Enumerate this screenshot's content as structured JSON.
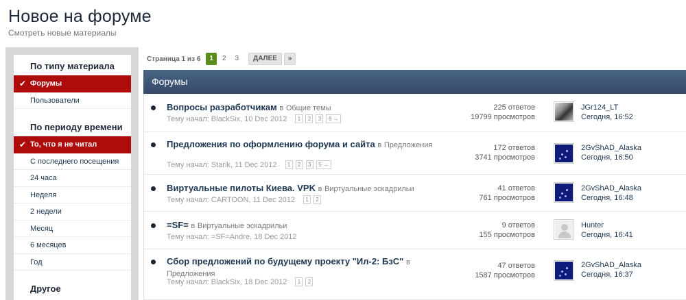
{
  "header": {
    "title": "Новое на форуме",
    "subtitle": "Смотреть новые материалы"
  },
  "sidebar": {
    "groups": [
      {
        "heading": "По типу материала",
        "items": [
          {
            "label": "Форумы",
            "active": true
          },
          {
            "label": "Пользователи",
            "active": false
          }
        ]
      },
      {
        "heading": "По периоду времени",
        "items": [
          {
            "label": "То, что я не читал",
            "active": true
          },
          {
            "label": "С последнего посещения",
            "active": false
          },
          {
            "label": "24 часа",
            "active": false
          },
          {
            "label": "Неделя",
            "active": false
          },
          {
            "label": "2 недели",
            "active": false
          },
          {
            "label": "Месяц",
            "active": false
          },
          {
            "label": "6 месяцев",
            "active": false
          },
          {
            "label": "Год",
            "active": false
          }
        ]
      },
      {
        "heading": "Другое",
        "items": []
      }
    ],
    "check_glyph": "✔"
  },
  "pagination": {
    "info": "Страница 1 из 6",
    "pages": [
      "1",
      "2",
      "3"
    ],
    "current": "1",
    "next_label": "ДАЛЕЕ",
    "last_label": "»"
  },
  "section": {
    "title": "Форумы"
  },
  "topics": [
    {
      "title": "Вопросы разработчикам",
      "in_label": "в",
      "forum": "Общие темы",
      "started": "Тему начал: BlackSix, 10 Dec 2012",
      "pages": [
        "1",
        "2",
        "3",
        "6 →"
      ],
      "replies": "225 ответов",
      "views": "19799 просмотров",
      "avatar": "wolf",
      "last_user": "JGr124_LT",
      "last_time": "Сегодня, 16:52"
    },
    {
      "title": "Предложения по оформлению форума и сайта",
      "in_label": "в",
      "forum": "Предложения",
      "started": "Тему начал: Starik, 11 Dec 2012",
      "pages": [
        "1",
        "2",
        "3",
        "5 →"
      ],
      "replies": "172 ответов",
      "views": "3741 просмотров",
      "avatar": "dark",
      "last_user": "2GvShAD_Alaska",
      "last_time": "Сегодня, 16:50"
    },
    {
      "title": "Виртуальные пилоты Киева. VPK",
      "in_label": "в",
      "forum": "Виртуальные эскадрильи",
      "started": "Тему начал: CARTOON, 11 Dec 2012",
      "pages": [
        "1",
        "2"
      ],
      "replies": "41 ответов",
      "views": "761 просмотров",
      "avatar": "dark",
      "last_user": "2GvShAD_Alaska",
      "last_time": "Сегодня, 16:48"
    },
    {
      "title": "=SF=",
      "in_label": "в",
      "forum": "Виртуальные эскадрильи",
      "started": "Тему начал: =SF=Andre, 18 Dec 2012",
      "pages": [],
      "replies": "9 ответов",
      "views": "155 просмотров",
      "avatar": "default",
      "last_user": "Hunter",
      "last_time": "Сегодня, 16:41"
    },
    {
      "title": "Сбор предложений по будущему проекту \"Ил-2: БзС\"",
      "in_label": "в",
      "forum": "Предложения",
      "started": "Тему начал: BlackSix, 18 Dec 2012",
      "pages": [
        "1",
        "2"
      ],
      "replies": "47 ответов",
      "views": "1587 просмотров",
      "avatar": "dark",
      "last_user": "2GvShAD_Alaska",
      "last_time": "Сегодня, 16:37"
    }
  ]
}
